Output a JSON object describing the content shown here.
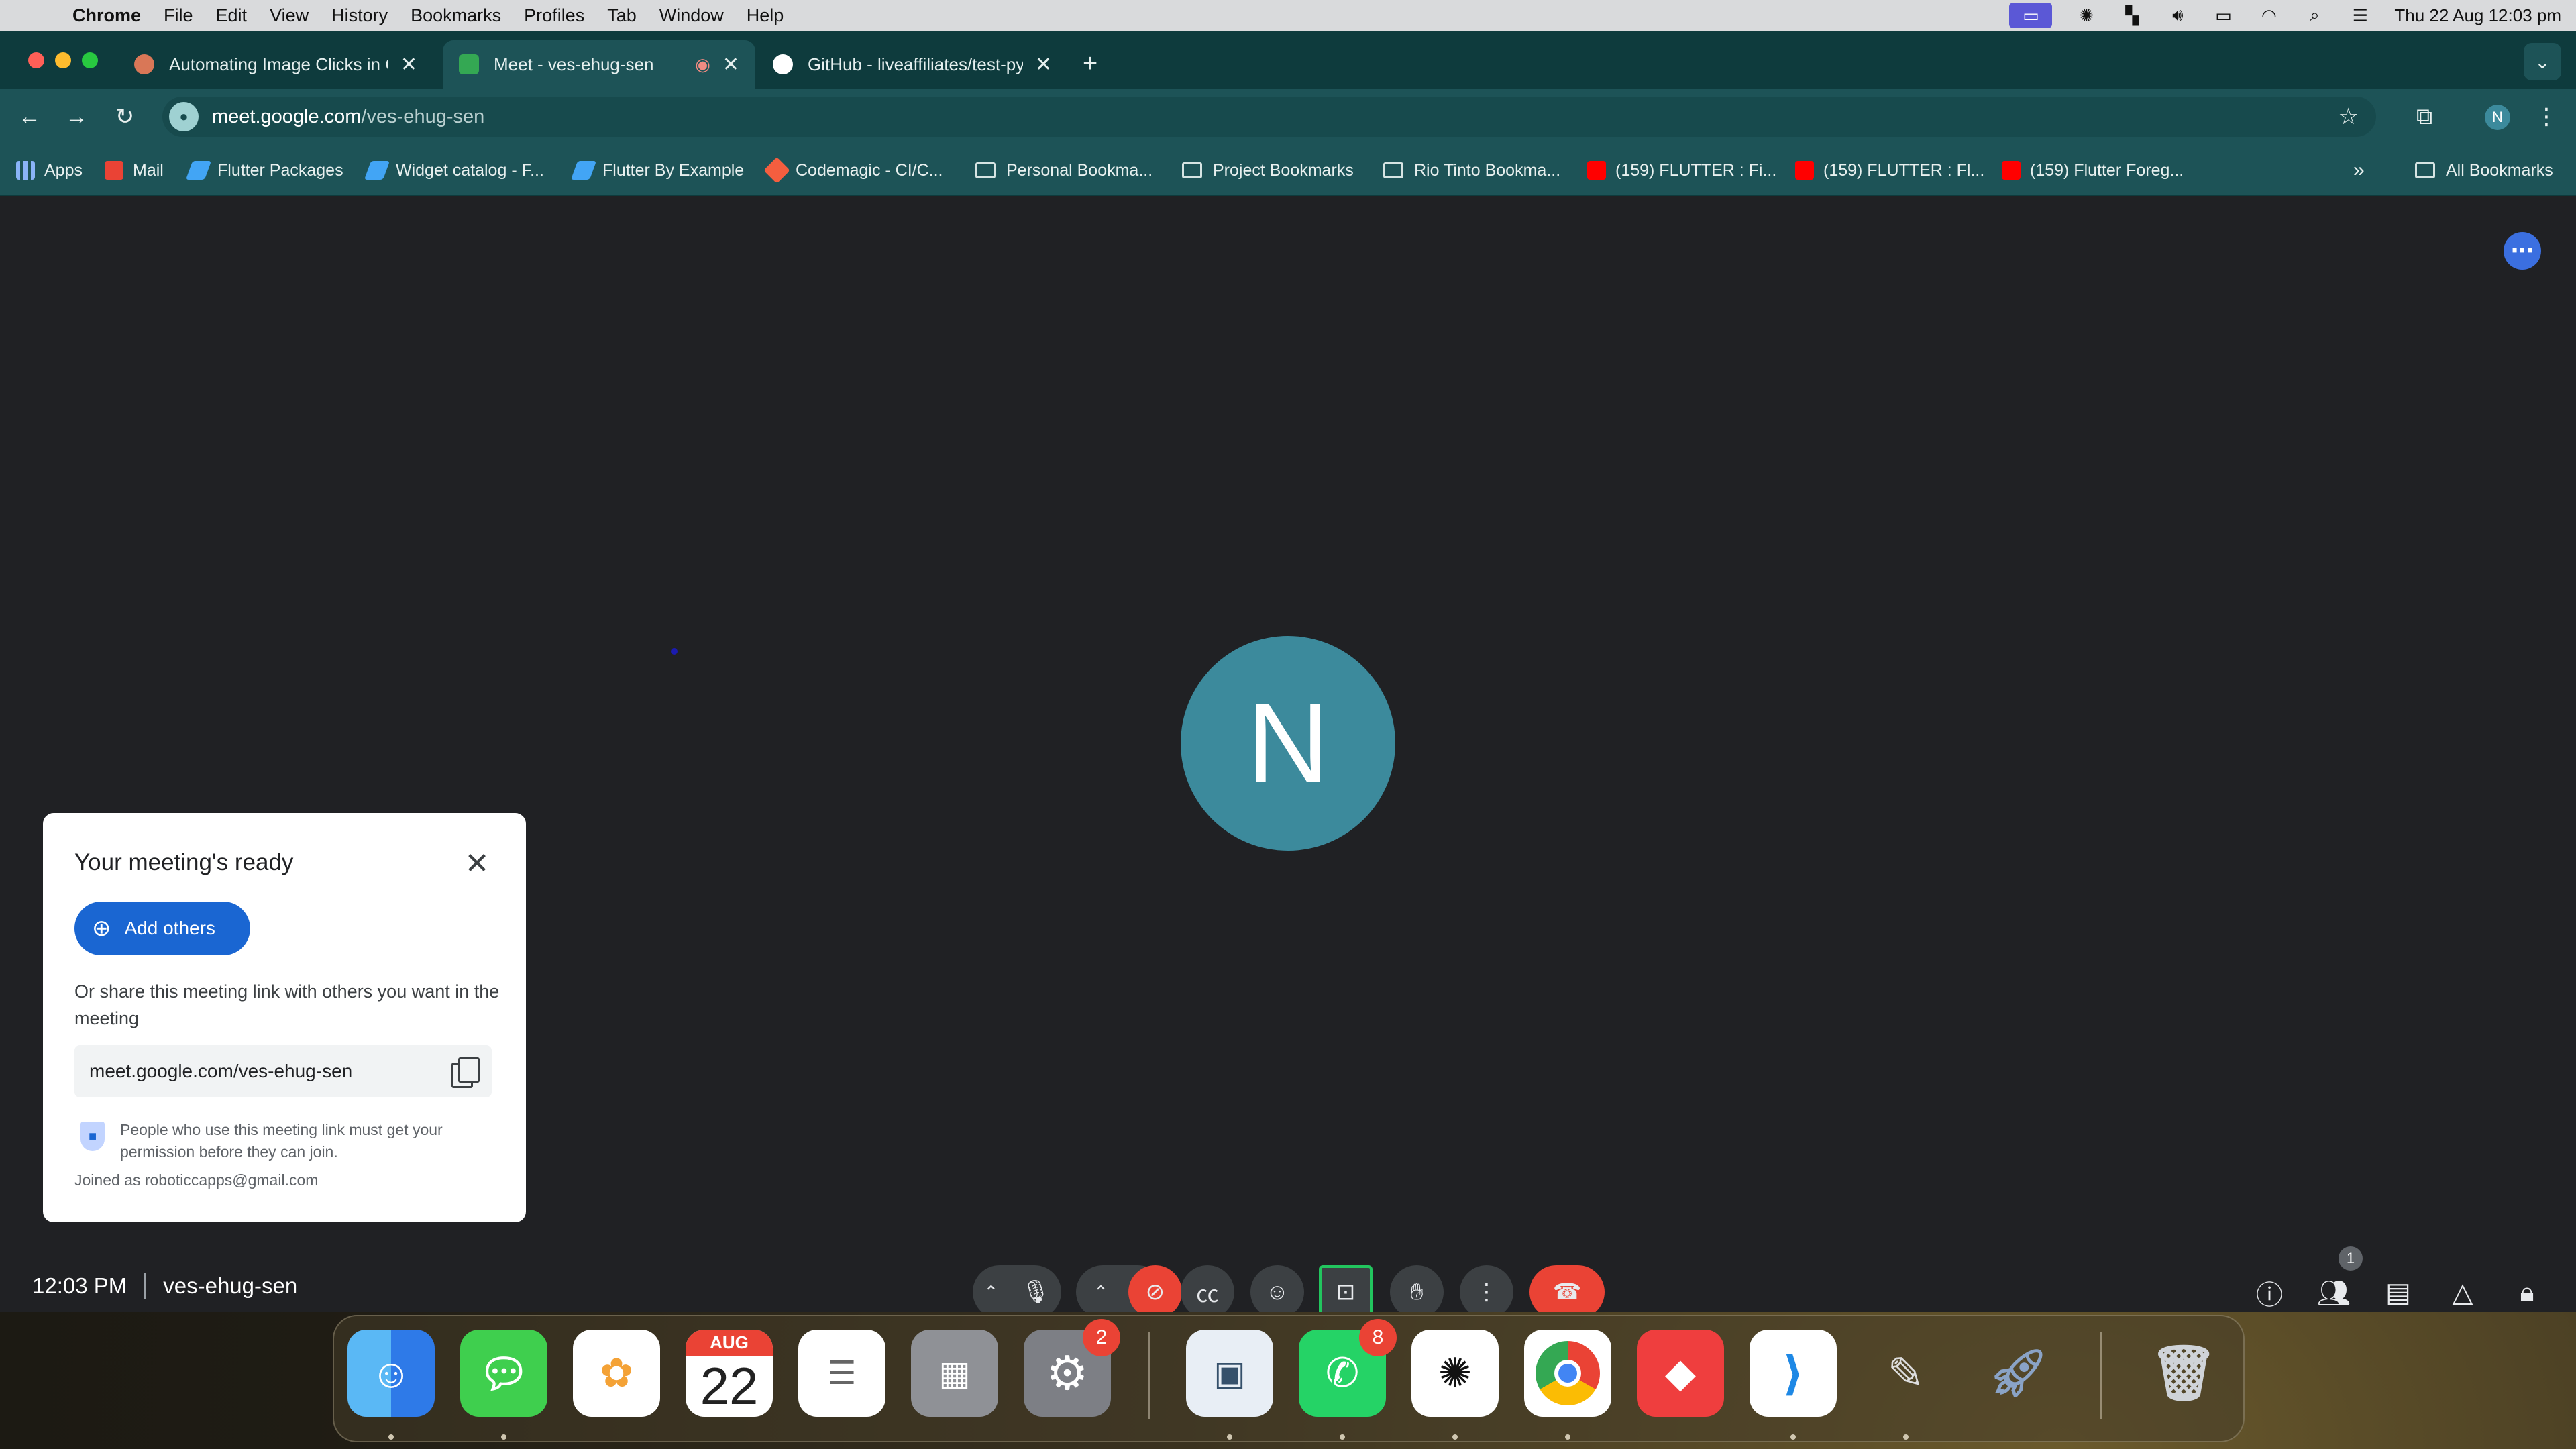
{
  "menubar": {
    "app": "Chrome",
    "items": [
      "File",
      "Edit",
      "View",
      "History",
      "Bookmarks",
      "Profiles",
      "Tab",
      "Window",
      "Help"
    ],
    "datetime": "Thu 22 Aug  12:03 pm"
  },
  "tabs": [
    {
      "title": "Automating Image Clicks in C",
      "favicon": "claude-icon",
      "color": "#d97757"
    },
    {
      "title": "Meet - ves-ehug-sen",
      "favicon": "meet-icon",
      "color": "#34a853"
    },
    {
      "title": "GitHub - liveaffiliates/test-py",
      "favicon": "github-icon",
      "color": "#ffffff"
    }
  ],
  "omnibox": {
    "domain": "meet.google.com",
    "path": "/ves-ehug-sen"
  },
  "profile_initial": "N",
  "bookmarks": [
    {
      "label": "Apps"
    },
    {
      "label": "Mail"
    },
    {
      "label": "Flutter Packages"
    },
    {
      "label": "Widget catalog - F..."
    },
    {
      "label": "Flutter By Example"
    },
    {
      "label": "Codemagic - CI/C..."
    },
    {
      "label": "Personal Bookma..."
    },
    {
      "label": "Project Bookmarks"
    },
    {
      "label": "Rio Tinto Bookma..."
    },
    {
      "label": "(159) FLUTTER : Fi..."
    },
    {
      "label": "(159) FLUTTER : Fl..."
    },
    {
      "label": "(159) Flutter Foreg..."
    },
    {
      "label": "All Bookmarks"
    }
  ],
  "meet": {
    "avatar_initial": "N",
    "card": {
      "title": "Your meeting's ready",
      "add_others": "Add others",
      "share_text": "Or share this meeting link with others you want in the meeting",
      "link": "meet.google.com/ves-ehug-sen",
      "permission_text": "People who use this meeting link must get your permission before they can join.",
      "joined_as": "Joined as roboticcapps@gmail.com"
    },
    "time": "12:03 PM",
    "meeting_code": "ves-ehug-sen",
    "participants_count": "1"
  },
  "dock": {
    "calendar_month": "AUG",
    "calendar_day": "22",
    "settings_badge": "2",
    "whatsapp_badge": "8"
  },
  "colors": {
    "accent": "#1a66d2",
    "end_call": "#ea4335",
    "avatar": "#3c8a9c",
    "tab_bar": "#0e3b3d",
    "toolbar": "#1d5357"
  }
}
